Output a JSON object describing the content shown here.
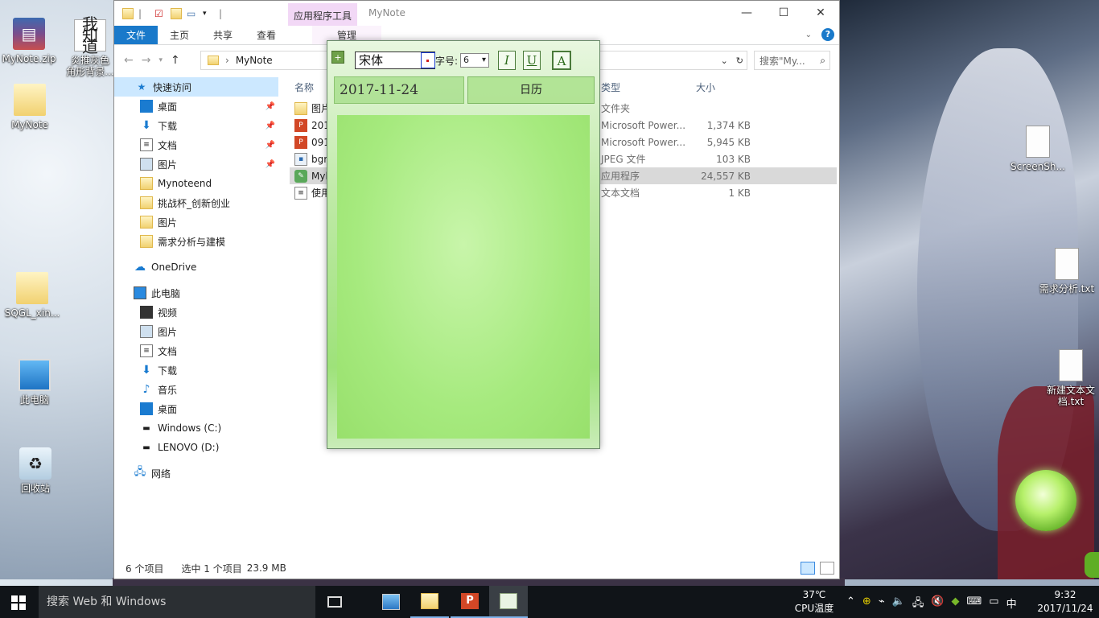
{
  "desktop": {
    "icons": [
      {
        "label": "MyNote.zip",
        "icon": "zip-archive-icon"
      },
      {
        "label": "炎推灰色\n角形背景...",
        "icon": "image-file-icon",
        "badge": "我知道"
      },
      {
        "label": "MyNote",
        "icon": "folder-icon"
      },
      {
        "label": "SQGL_xin...",
        "icon": "folder-icon"
      },
      {
        "label": "此电脑",
        "icon": "computer-icon"
      },
      {
        "label": "回收站",
        "icon": "recycle-bin-icon"
      },
      {
        "label": "ScreenSh...",
        "icon": "text-file-icon"
      },
      {
        "label": "需求分析.txt",
        "icon": "text-file-icon"
      },
      {
        "label": "新建文本文\n档.txt",
        "icon": "text-file-icon"
      }
    ]
  },
  "explorer": {
    "title": "MyNote",
    "context_tab": "应用程序工具",
    "ribbon": {
      "file": "文件",
      "tabs": [
        "主页",
        "共享",
        "查看"
      ],
      "manage": "管理"
    },
    "address": {
      "path": "MyNote",
      "search_placeholder": "搜索\"My..."
    },
    "nav": {
      "quick_access": "快速访问",
      "quick_items": [
        "桌面",
        "下载",
        "文档",
        "图片",
        "Mynoteend",
        "挑战杯_创新创业",
        "图片",
        "需求分析与建模"
      ],
      "onedrive": "OneDrive",
      "this_pc": "此电脑",
      "pc_items": [
        "视频",
        "图片",
        "文档",
        "下载",
        "音乐",
        "桌面",
        "Windows (C:)",
        "LENOVO (D:)"
      ],
      "network": "网络"
    },
    "columns": {
      "name": "名称",
      "type": "类型",
      "size": "大小"
    },
    "files": [
      {
        "name": "图片",
        "type": "文件夹",
        "size": "",
        "icon": "folder-icon"
      },
      {
        "name": "201",
        "type": "Microsoft Power...",
        "size": "1,374 KB",
        "icon": "powerpoint-file-icon"
      },
      {
        "name": "091",
        "type": "Microsoft Power...",
        "size": "5,945 KB",
        "icon": "powerpoint-file-icon"
      },
      {
        "name": "bgr",
        "type": "JPEG 文件",
        "size": "103 KB",
        "icon": "jpeg-file-icon"
      },
      {
        "name": "Myl",
        "type": "应用程序",
        "size": "24,557 KB",
        "icon": "application-icon"
      },
      {
        "name": "使用",
        "type": "文本文档",
        "size": "1 KB",
        "icon": "text-file-icon"
      }
    ],
    "status": {
      "count": "6 个项目",
      "selection": "选中 1 个项目",
      "size": "23.9 MB"
    }
  },
  "mynote": {
    "font_name": "宋体",
    "size_label": "字号:",
    "size_value": "6",
    "italic": "I",
    "underline": "U",
    "color_btn": "A",
    "date": "2017-11-24",
    "calendar": "日历"
  },
  "taskbar": {
    "search": "搜索 Web 和 Windows",
    "cpu_temp": "37℃",
    "cpu_label": "CPU温度",
    "ime": "中",
    "time": "9:32",
    "date": "2017/11/24"
  },
  "colors": {
    "accent": "#1979ca",
    "context_tab": "#f2d8f6",
    "selection": "#cce8ff",
    "mynote_green": "#a6ea7e"
  }
}
